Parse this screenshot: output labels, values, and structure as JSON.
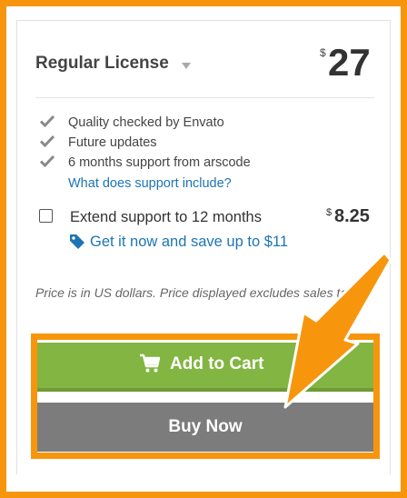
{
  "license": {
    "title": "Regular License",
    "currency": "$",
    "price": "27"
  },
  "features": [
    {
      "icon": "check-icon",
      "text": "Quality checked by Envato"
    },
    {
      "icon": "check-icon",
      "text": "Future updates"
    },
    {
      "icon": "check-icon",
      "text": "6 months support from arscode"
    }
  ],
  "support_link": "What does support include?",
  "extend": {
    "label": "Extend support to 12 months",
    "currency": "$",
    "price": "8.25",
    "save_text": "Get it now and save up to $11",
    "save_icon": "tag-icon"
  },
  "note": "Price is in US dollars. Price displayed excludes sales tax.",
  "buttons": {
    "add_to_cart": "Add to Cart",
    "buy_now": "Buy Now"
  },
  "colors": {
    "highlight": "#f7960d",
    "add_to_cart": "#82b541",
    "buy_now": "#7c7c7c",
    "link": "#1d75b3"
  }
}
